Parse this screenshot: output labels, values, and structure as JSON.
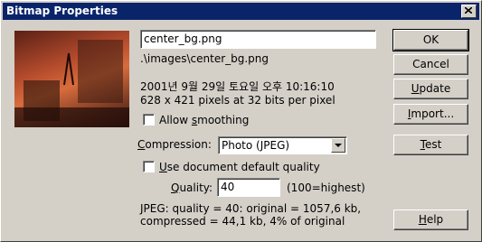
{
  "window": {
    "title": "Bitmap Properties"
  },
  "file": {
    "name": "center_bg.png",
    "path": ".\\images\\center_bg.png",
    "modified": "2001년 9월 29일 토요일 오후 10:16:10",
    "dimensions": "628 x 421 pixels at 32 bits per pixel"
  },
  "options": {
    "allow_smoothing": {
      "pre": "Allow ",
      "key": "s",
      "post": "moothing",
      "checked": false
    },
    "compression": {
      "pre": "",
      "key": "C",
      "post": "ompression:",
      "value": "Photo (JPEG)"
    },
    "use_default_quality": {
      "pre": "",
      "key": "U",
      "post": "se document default quality",
      "checked": false
    },
    "quality": {
      "pre": "",
      "key": "Q",
      "post": "uality:",
      "value": "40",
      "hint": "(100=highest)"
    }
  },
  "summary": {
    "line1": "JPEG: quality = 40: original = 1057,6 kb,",
    "line2": "compressed = 44,1 kb, 4% of original"
  },
  "buttons": {
    "ok": "OK",
    "cancel": "Cancel",
    "update": {
      "key": "U",
      "post": "pdate"
    },
    "import": {
      "key": "I",
      "post": "mport..."
    },
    "test": {
      "key": "T",
      "post": "est"
    },
    "help": {
      "key": "H",
      "post": "elp"
    }
  },
  "icons": {
    "close": "close-icon",
    "dropdown": "chevron-down-icon"
  }
}
